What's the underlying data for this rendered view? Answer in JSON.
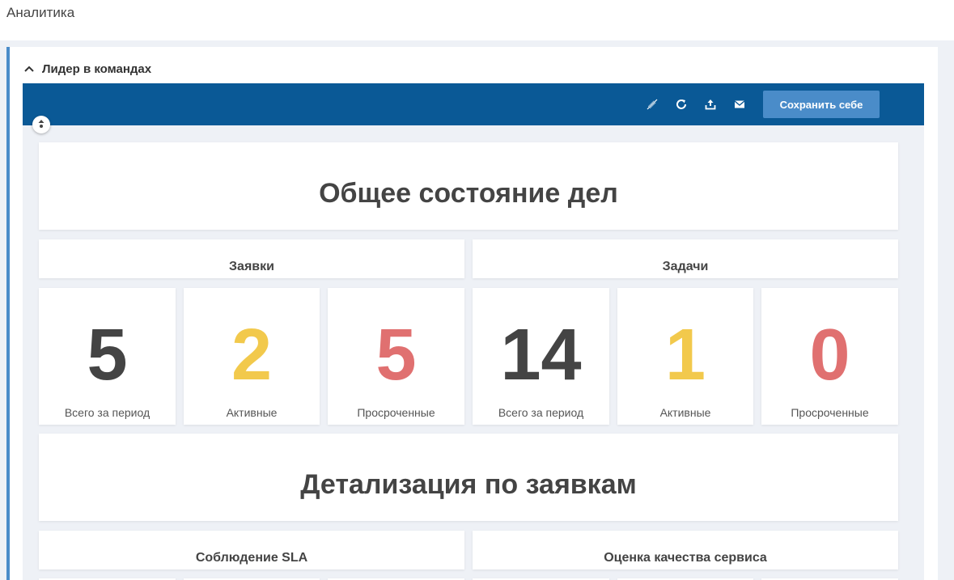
{
  "page": {
    "title": "Аналитика"
  },
  "panel": {
    "label": "Лидер в командах"
  },
  "toolbar": {
    "icons": [
      "no-edit-icon",
      "refresh-icon",
      "export-icon",
      "mail-icon"
    ],
    "save_label": "Сохранить себе"
  },
  "colors": {
    "toolbar_bg": "#0a5996",
    "accent": "#4a8cc9",
    "value_dark": "#444444",
    "value_yellow": "#f2c94c",
    "value_red": "#e07070"
  },
  "dashboard": {
    "section1_title": "Общее состояние дел",
    "group_requests": "Заявки",
    "group_tasks": "Задачи",
    "requests": [
      {
        "value": "5",
        "label": "Всего за период",
        "tone": "dark"
      },
      {
        "value": "2",
        "label": "Активные",
        "tone": "yellow"
      },
      {
        "value": "5",
        "label": "Просроченные",
        "tone": "red"
      }
    ],
    "tasks": [
      {
        "value": "14",
        "label": "Всего за период",
        "tone": "dark"
      },
      {
        "value": "1",
        "label": "Активные",
        "tone": "yellow"
      },
      {
        "value": "0",
        "label": "Просроченные",
        "tone": "red"
      }
    ],
    "section2_title": "Детализация по заявкам",
    "sla_title": "Соблюдение SLA",
    "quality_title": "Оценка качества сервиса"
  }
}
